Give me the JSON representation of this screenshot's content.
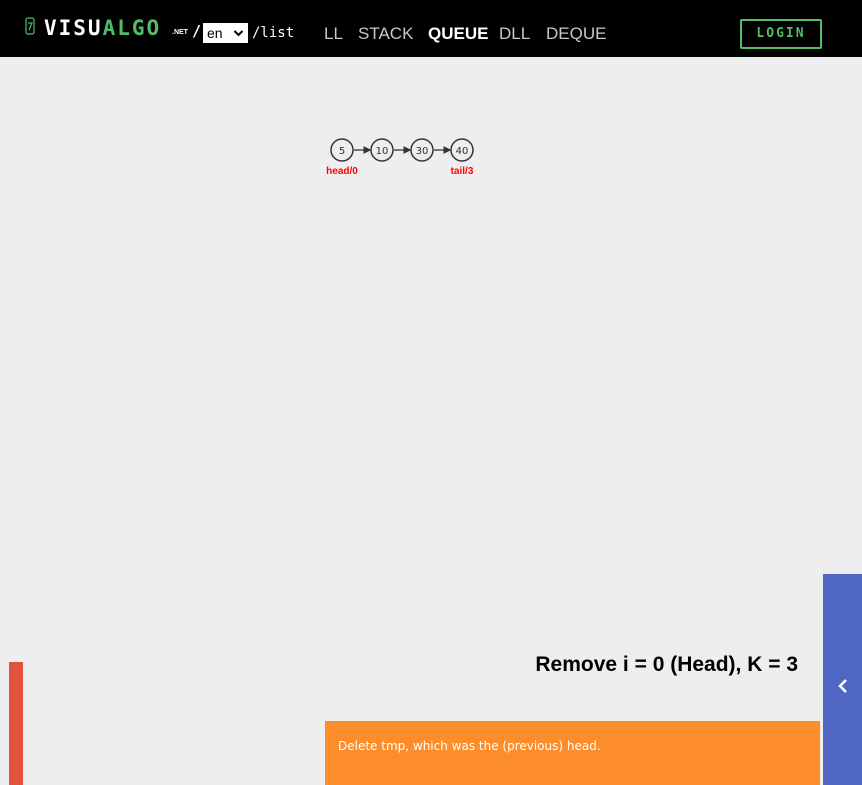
{
  "header": {
    "logo_icon": "thumb-drive-icon",
    "logo_text_white": "VISU",
    "logo_text_green": "ALGO",
    "logo_suffix": ".NET",
    "slash": "/",
    "language": "en",
    "path": "/list",
    "nav": [
      {
        "label": "LL",
        "active": false
      },
      {
        "label": "STACK",
        "active": false
      },
      {
        "label": "QUEUE",
        "active": true
      },
      {
        "label": "DLL",
        "active": false
      },
      {
        "label": "DEQUE",
        "active": false
      }
    ],
    "login_label": "LOGIN"
  },
  "visualization": {
    "nodes": [
      "5",
      "10",
      "30",
      "40"
    ],
    "head_label": "head/0",
    "tail_label": "tail/3",
    "label_color": "#ff0000"
  },
  "status": {
    "text": "Remove i = 0 (Head), K = 3"
  },
  "codetrace": {
    "text": "Delete tmp, which was the (previous) head.",
    "color": "#fd8d2b"
  },
  "panels": {
    "right_color": "#4f66c4",
    "right_icon": "chevron-left-icon",
    "left_color": "#e2513c"
  },
  "colors": {
    "brand_green": "#52bc69"
  }
}
